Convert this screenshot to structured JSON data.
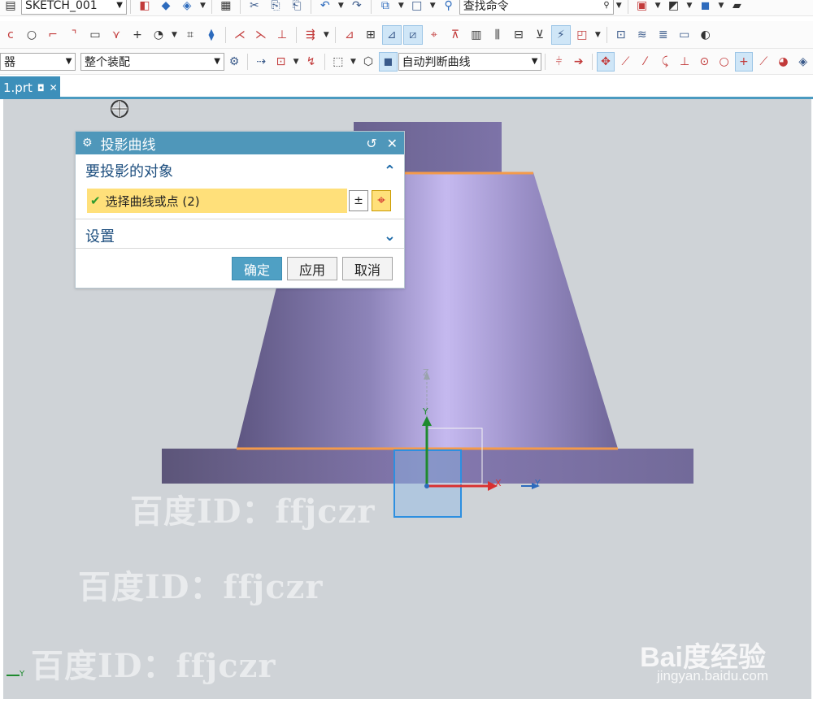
{
  "toolbar": {
    "sketch_name": "SKETCH_001",
    "search_placeholder": "查找命令",
    "filter_label": "器",
    "assembly_scope": "整个装配",
    "curve_rule": "自动判断曲线"
  },
  "file_tab": {
    "label": "1.prt"
  },
  "dialog": {
    "title": "投影曲线",
    "group_objects": "要投影的对象",
    "selection_text": "选择曲线或点 (2)",
    "group_settings": "设置",
    "ok_label": "确定",
    "apply_label": "应用",
    "cancel_label": "取消",
    "reset_icon": "reset-icon",
    "close_icon": "close-icon"
  },
  "axes": {
    "x": "X",
    "y": "Y",
    "z": "Z",
    "corner_y": "Y"
  },
  "watermark": {
    "text1": "百度ID：ffjczr",
    "text2": "百度ID：ffjczr",
    "text3": "百度ID：ffjczr"
  },
  "branding": {
    "logo": "Bai度经验",
    "url": "jingyan.baidu.com"
  },
  "colors": {
    "accent": "#4f97ba",
    "highlight": "#ffe07a",
    "model": "#8a7fb8",
    "edge": "#f39a4b"
  }
}
